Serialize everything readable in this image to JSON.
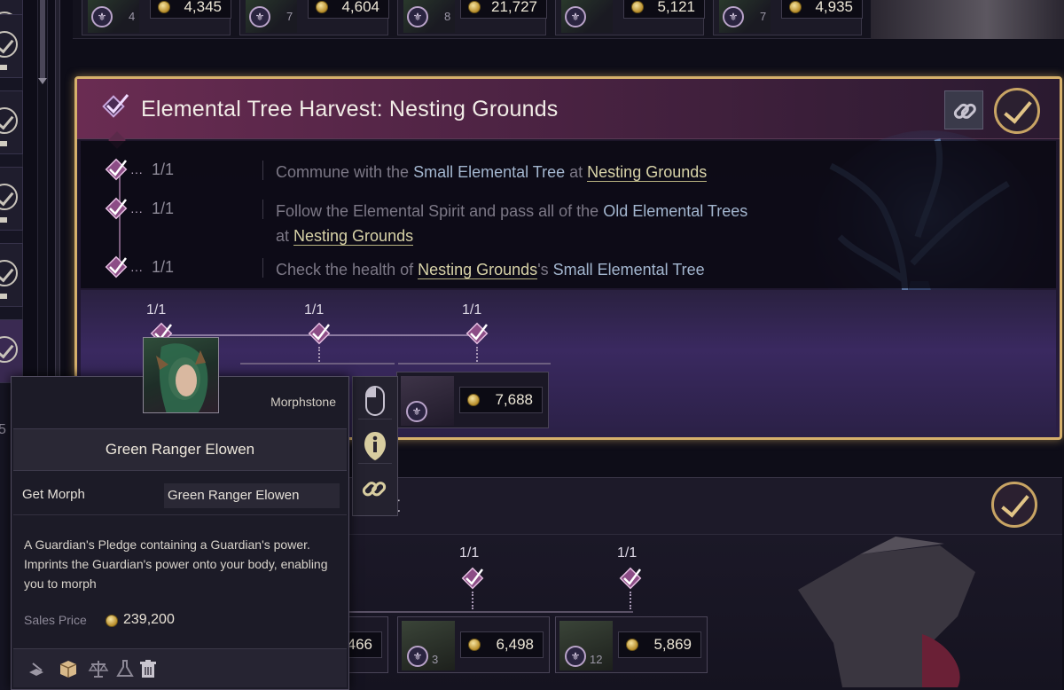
{
  "top_rewards": [
    {
      "badge": "⚜",
      "qty": "4",
      "value": "4,345"
    },
    {
      "badge": "⚜",
      "qty": "7",
      "value": "4,604"
    },
    {
      "badge": "⚜",
      "qty": "8",
      "value": "21,727"
    },
    {
      "badge": "⚜",
      "qty": "",
      "value": "5,121"
    },
    {
      "badge": "⚜",
      "qty": "7",
      "value": "4,935"
    }
  ],
  "quest": {
    "title": "Elemental Tree Harvest: Nesting Grounds",
    "objectives": [
      {
        "count": "1/1",
        "parts": [
          "Commune with the ",
          "Small Elemental Tree",
          " at ",
          "Nesting Grounds",
          ""
        ]
      },
      {
        "count": "1/1",
        "parts": [
          "Follow the Elemental Spirit and pass all of the ",
          "Old Elemental Trees",
          "",
          "at ",
          "Nesting Grounds"
        ]
      },
      {
        "count": "1/1",
        "parts": [
          "Check the health of ",
          "Nesting Grounds",
          "'s ",
          "Small Elemental Tree",
          ""
        ]
      }
    ],
    "progress_counts": [
      "1/1",
      "1/1",
      "1/1"
    ],
    "reward": {
      "badge": "⚜",
      "value": "7,688"
    }
  },
  "quest2": {
    "title_fragment": "t",
    "progress_counts": [
      "1/1",
      "1/1"
    ],
    "rewards": [
      {
        "value": "466"
      },
      {
        "badge": "⚜",
        "qty": "3",
        "value": "6,498"
      },
      {
        "badge": "⚜",
        "qty": "12",
        "value": "5,869"
      }
    ]
  },
  "tooltip": {
    "category": "Morphstone",
    "name": "Green Ranger Elowen",
    "morph_label": "Get Morph",
    "morph_value": "Green Ranger Elowen",
    "description": "A Guardian's Pledge containing a Guardian's power. Imprints the Guardian's power onto your body, enabling you to morph",
    "price_label": "Sales Price",
    "price_value": "239,200"
  },
  "left_rail_partial_text": "5",
  "icons": {
    "action_buttons": [
      "mouse-icon",
      "info-icon",
      "link-icon"
    ],
    "footer": [
      "book-quill-icon",
      "box-icon",
      "scales-icon",
      "flask-icon",
      "trash-icon"
    ]
  },
  "colors": {
    "highlight_blue": "#a3b6cf",
    "place_yellow": "#d8d3a8",
    "gold_border": "#d6b06b",
    "header_magenta": "#6a2c52"
  }
}
